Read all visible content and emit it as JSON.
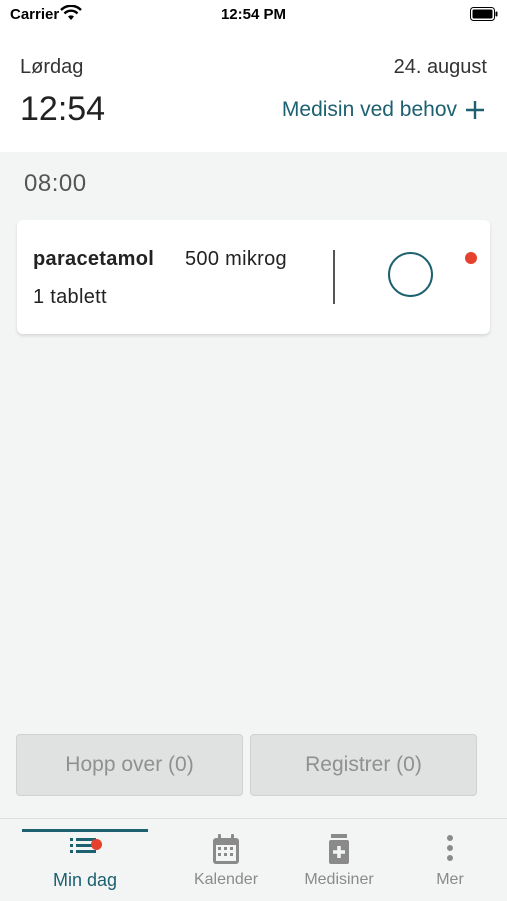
{
  "status_bar": {
    "carrier": "Carrier",
    "time": "12:54 PM"
  },
  "header": {
    "weekday": "Lørdag",
    "date": "24. august",
    "clock": "12:54",
    "prn_label": "Medisin ved behov"
  },
  "schedule": {
    "time_slot": "08:00",
    "medication": {
      "name": "paracetamol",
      "strength": "500 mikrog",
      "dose": "1 tablett"
    }
  },
  "actions": {
    "skip_label": "Hopp over (0)",
    "register_label": "Registrer (0)"
  },
  "tabs": [
    {
      "label": "Min dag",
      "icon": "list-icon",
      "active": true,
      "badge": true
    },
    {
      "label": "Kalender",
      "icon": "calendar-icon",
      "active": false
    },
    {
      "label": "Medisiner",
      "icon": "medicine-icon",
      "active": false
    },
    {
      "label": "Mer",
      "icon": "more-icon",
      "active": false
    }
  ],
  "colors": {
    "accent": "#1d6070",
    "alert": "#e5412d",
    "background": "#f3f5f4"
  }
}
